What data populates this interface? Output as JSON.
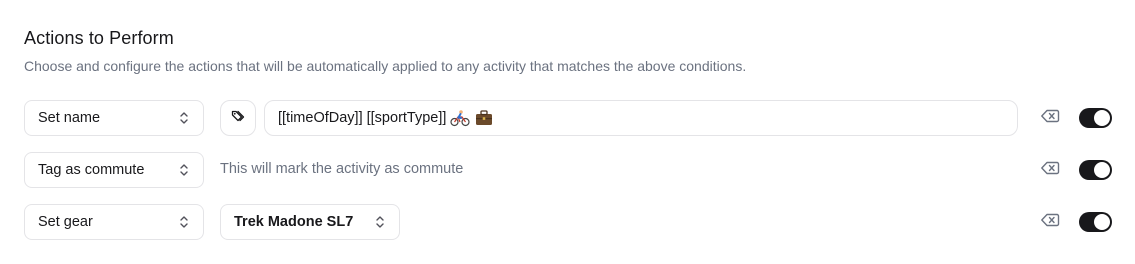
{
  "section": {
    "title": "Actions to Perform",
    "description": "Choose and configure the actions that will be automatically applied to any activity that matches the above conditions."
  },
  "actions": [
    {
      "action_label": "Set name",
      "name_template": "[[timeOfDay]] [[sportType]]",
      "emojis": [
        "bicyclist-emoji",
        "briefcase-emoji"
      ],
      "enabled": true
    },
    {
      "action_label": "Tag as commute",
      "note": "This will mark the activity as commute",
      "enabled": true
    },
    {
      "action_label": "Set gear",
      "gear_value": "Trek Madone SL7",
      "enabled": true
    }
  ],
  "colors": {
    "toggle_on": "#18181b",
    "border": "#e4e4e7",
    "muted_text": "#6b7280"
  }
}
